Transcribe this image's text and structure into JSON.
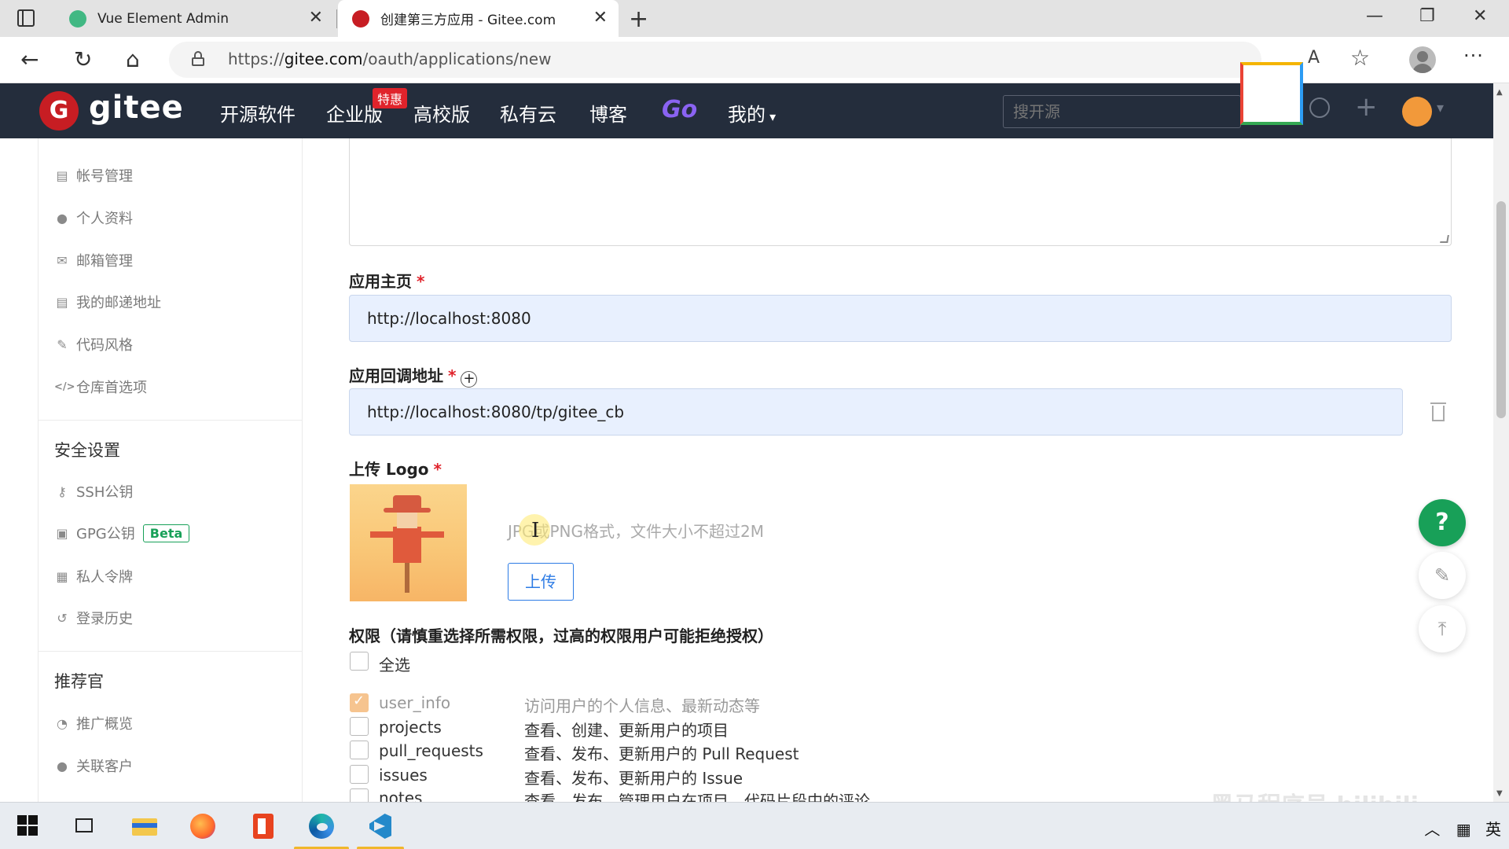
{
  "browser": {
    "tabs": [
      {
        "title": "Vue Element Admin",
        "favicon_color": "#41b883",
        "active": false
      },
      {
        "title": "创建第三方应用 - Gitee.com",
        "favicon_color": "#c71d23",
        "active": true
      }
    ],
    "url_prefix": "https://",
    "url_domain": "gitee.com",
    "url_path": "/oauth/applications/new",
    "tab_close": "✕",
    "new_tab": "+",
    "nav": {
      "back": "←",
      "reload": "↻",
      "home": "⌂"
    },
    "window": {
      "minimize": "—",
      "restore": "❐",
      "close": "✕"
    },
    "toolbar_icons": [
      "read-aloud-icon",
      "favorites-icon",
      "profile-icon",
      "more-icon"
    ],
    "read_aloud": "A",
    "favorites": "☆",
    "more": "···"
  },
  "gitee_header": {
    "logo_glyph": "G",
    "brand": "gitee",
    "nav": [
      "开源软件",
      "企业版",
      "高校版",
      "私有云",
      "博客",
      "Go",
      "我的"
    ],
    "badge": "特惠",
    "search_placeholder": "搜开源",
    "brand_color": "#c71d23",
    "plus": "+"
  },
  "sidebar": {
    "group1": [
      {
        "icon": "id-card-icon",
        "glyph": "▤",
        "label": "帐号管理"
      },
      {
        "icon": "user-icon",
        "glyph": "●",
        "label": "个人资料"
      },
      {
        "icon": "mail-icon",
        "glyph": "✉",
        "label": "邮箱管理"
      },
      {
        "icon": "address-card-icon",
        "glyph": "▤",
        "label": "我的邮递地址"
      },
      {
        "icon": "brush-icon",
        "glyph": "✎",
        "label": "代码风格"
      },
      {
        "icon": "code-icon",
        "glyph": "</>",
        "label": "仓库首选项"
      }
    ],
    "security_title": "安全设置",
    "group2": [
      {
        "icon": "key-icon",
        "glyph": "⚷",
        "label": "SSH公钥"
      },
      {
        "icon": "lock-icon",
        "glyph": "▣",
        "label": "GPG公钥"
      },
      {
        "icon": "token-icon",
        "glyph": "▦",
        "label": "私人令牌"
      },
      {
        "icon": "history-icon",
        "glyph": "↺",
        "label": "登录历史"
      }
    ],
    "beta": "Beta",
    "referral_title": "推荐官",
    "group3": [
      {
        "icon": "dashboard-icon",
        "glyph": "◔",
        "label": "推广概览"
      },
      {
        "icon": "user-link-icon",
        "glyph": "●",
        "label": "关联客户"
      }
    ]
  },
  "form": {
    "homepage_label": "应用主页",
    "homepage_value": "http://localhost:8080",
    "callback_label": "应用回调地址",
    "callback_value": "http://localhost:8080/tp/gitee_cb",
    "add_glyph": "+",
    "required": "*",
    "logo_label": "上传 Logo",
    "logo_hint": "JPG或PNG格式，文件大小不超过2M",
    "upload_button": "上传",
    "permissions_title": "权限（请慎重选择所需权限，过高的权限用户可能拒绝授权）",
    "select_all": "全选",
    "scopes": [
      {
        "name": "user_info",
        "desc": "访问用户的个人信息、最新动态等",
        "checked": true
      },
      {
        "name": "projects",
        "desc": "查看、创建、更新用户的项目",
        "checked": false
      },
      {
        "name": "pull_requests",
        "desc": "查看、发布、更新用户的 Pull Request",
        "checked": false
      },
      {
        "name": "issues",
        "desc": "查看、发布、更新用户的 Issue",
        "checked": false
      },
      {
        "name": "notes",
        "desc": "查看、发布、管理用户在项目、代码片段中的评论",
        "checked": false
      }
    ]
  },
  "floating": {
    "help": "?",
    "feedback": "✎",
    "top": "⤒"
  },
  "taskbar": {
    "apps": [
      "windows-start-icon",
      "task-view-icon",
      "file-explorer-icon",
      "firefox-icon",
      "office-icon",
      "edge-icon",
      "vscode-icon"
    ],
    "tray_text": "英",
    "tray_chevron": "︿"
  },
  "watermark": "黑马程序员 bilibili"
}
